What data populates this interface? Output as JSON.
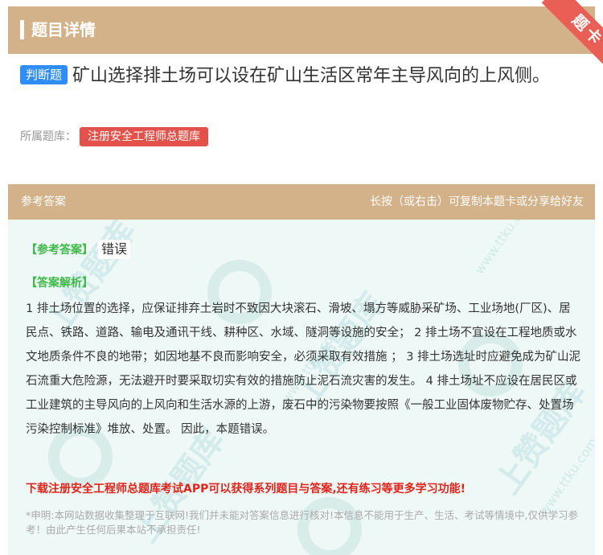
{
  "header": {
    "title": "题目详情"
  },
  "ribbon": {
    "label": "题卡"
  },
  "question": {
    "type_tag": "判断题",
    "text": "矿山选择排土场可以设在矿山生活区常年主导风向的上风侧。",
    "source_label": "所属题库：",
    "source_name": "注册安全工程师总题库"
  },
  "answer_header": {
    "left": "参考答案",
    "right": "长按（或右击）可复制本题卡或分享给好友"
  },
  "answer": {
    "label": "【参考答案】",
    "value": "错误",
    "analysis_label": "【答案解析】",
    "analysis_text": "1 排土场位置的选择，应保证排弃土岩时不致因大块滚石、滑坡、塌方等威胁采矿场、工业场地(厂区)、居民点、铁路、道路、输电及通讯干线、耕种区、水域、隧洞等设施的安全； 2 排土场不宜设在工程地质或水文地质条件不良的地带；如因地基不良而影响安全，必须采取有效措施 ； 3 排土场选址时应避免成为矿山泥石流重大危险源，无法避开时要采取切实有效的措施防止泥石流灾害的发生。 4 排土场址不应设在居民区或工业建筑的主导风向的上风向和生活水源的上游，废石中的污染物要按照《一般工业固体废物贮存、处置场污染控制标准》堆放、处置。 因此，本题错误。",
    "promo": "下载注册安全工程师总题库考试APP可以获得系列题目与答案,还有练习等更多学习功能!",
    "disclaimer": "*申明:本网站数据收集整理于互联网!我们并未能对答案信息进行核对!本信息不能用于生产、生活、考试等情境中,仅供学习参考！由此产生任何后果本站不承担责任!"
  },
  "watermark": {
    "brand": "上赞题库",
    "domain": "www.ttku.com"
  }
}
